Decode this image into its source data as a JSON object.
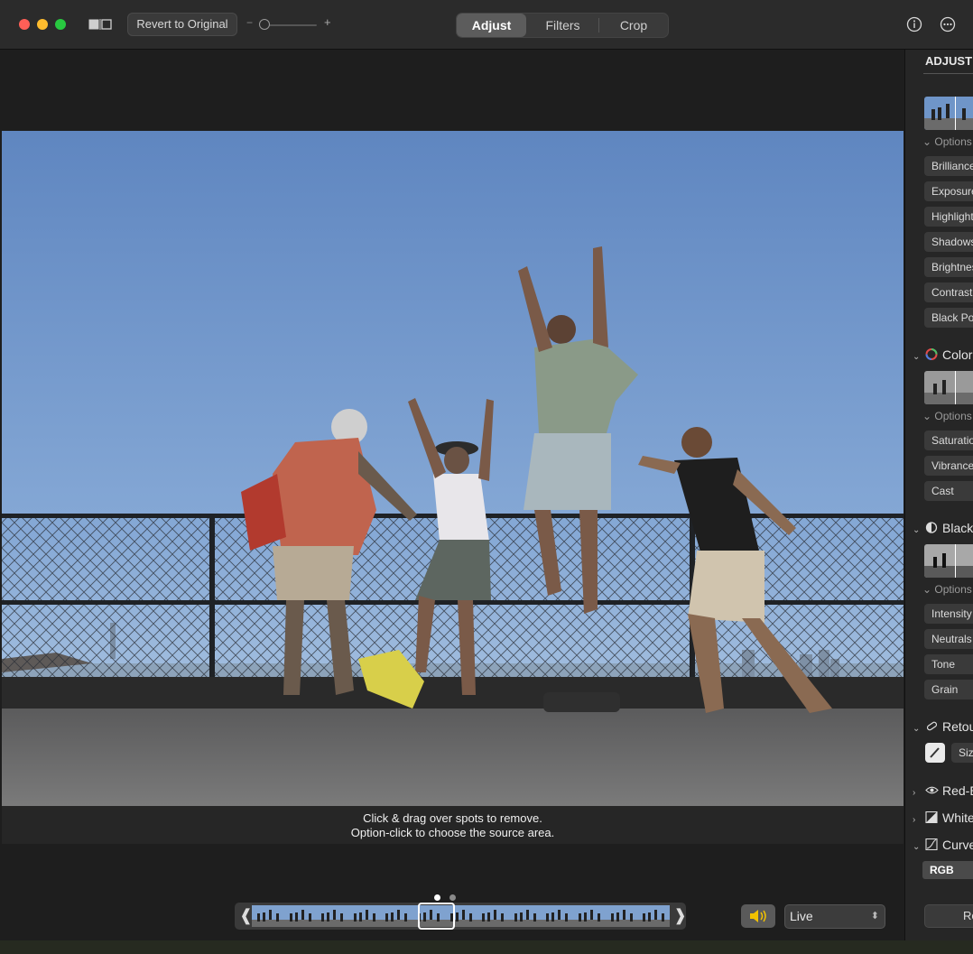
{
  "toolbar": {
    "revert_label": "Revert to Original",
    "zoom_minus": "−",
    "zoom_plus": "+",
    "tabs": [
      {
        "label": "Adjust",
        "active": true
      },
      {
        "label": "Filters",
        "active": false
      },
      {
        "label": "Crop",
        "active": false
      }
    ],
    "icons": [
      "split-view-icon",
      "info-icon",
      "more-icon"
    ]
  },
  "canvas": {
    "hint_line1": "Click & drag over spots to remove.",
    "hint_line2": "Option-click to choose the source area."
  },
  "live_photo": {
    "mode": "Live",
    "frame_count": 13,
    "selected_frame": 6
  },
  "sidebar": {
    "title": "ADJUST",
    "light": {
      "options": "Options",
      "items": [
        "Brilliance",
        "Exposure",
        "Highlights",
        "Shadows",
        "Brightness",
        "Contrast",
        "Black Point"
      ]
    },
    "color": {
      "title": "Color",
      "options": "Options",
      "items": [
        "Saturation",
        "Vibrance",
        "Cast"
      ]
    },
    "bw": {
      "title": "Black & White",
      "options": "Options",
      "items": [
        "Intensity",
        "Neutrals",
        "Tone",
        "Grain"
      ]
    },
    "retouch": {
      "title": "Retouch",
      "size_label": "Size"
    },
    "redeye": {
      "title": "Red-Eye"
    },
    "white_balance": {
      "title": "White Balance"
    },
    "curves": {
      "title": "Curves",
      "channel": "RGB"
    },
    "reset_label": "Reset"
  },
  "colors": {
    "sky_top": "#5f88c2",
    "sky_bottom": "#a8c3e0",
    "pavement": "#6b6b6b",
    "accent": "#ffffff"
  }
}
